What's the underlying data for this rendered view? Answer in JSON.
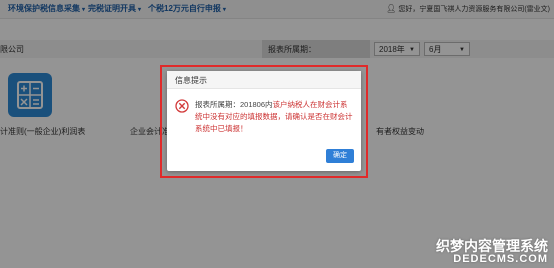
{
  "nav": {
    "items": [
      {
        "label": "环境保护税信息采集",
        "caret": "▾"
      },
      {
        "label": "完税证明开具",
        "caret": "▾"
      },
      {
        "label": "个税12万元自行申报",
        "caret": "▾"
      }
    ],
    "user_icon": "user-icon",
    "user_text": "您好，宁夏国飞祺人力资源服务有限公司(雷业文)"
  },
  "header": {
    "company_suffix": "限公司",
    "period_label": "报表所属期：",
    "year_value": "2018年",
    "month_value": "6月"
  },
  "reports": [
    {
      "label": "计准则(一般企业)利润表"
    },
    {
      "label": "企业会计准"
    },
    {
      "label": "有者权益变动"
    }
  ],
  "dialog": {
    "title": "信息提示",
    "message_prefix": "报表所属期：201806内",
    "message_rest": "该户纳税人在财会计系统中没有对应的填报数据，请确认是否在财会计系统中已填报！",
    "confirm_label": "确定"
  },
  "watermark": {
    "line1": "织梦内容管理系统",
    "line2": "DEDECMS.COM"
  },
  "colors": {
    "nav_text": "#1e5fa8",
    "error_red": "#c33",
    "primary_blue": "#2f7fd7",
    "highlight_red": "#e02a2a"
  }
}
